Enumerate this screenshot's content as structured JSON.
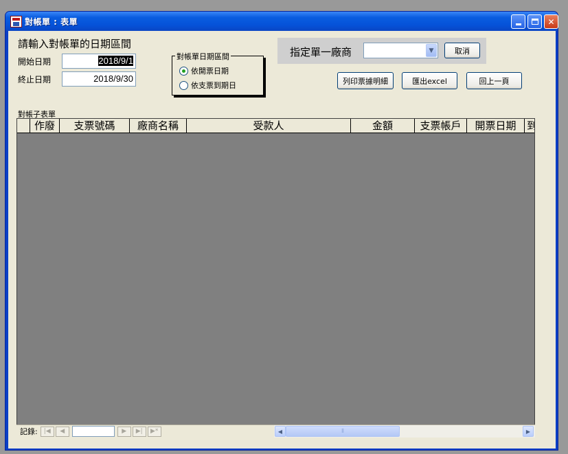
{
  "window": {
    "title": "對帳單 : 表單",
    "controls": {
      "minimize": "minimize-icon",
      "maximize": "maximize-icon",
      "close": "close-icon"
    }
  },
  "form": {
    "prompt": "請輸入對帳單的日期區間",
    "start_label": "開始日期",
    "start_value": "2018/9/1",
    "end_label": "終止日期",
    "end_value": "2018/9/30",
    "range_group": {
      "title": "對帳單日期區間",
      "options": [
        {
          "label": "依開票日期",
          "checked": true
        },
        {
          "label": "依支票到期日",
          "checked": false
        }
      ]
    },
    "vendor": {
      "label": "指定單一廠商",
      "selected": "",
      "cancel_label": "取消"
    },
    "buttons": {
      "print": "列印票據明細",
      "export": "匯出excel",
      "back": "回上一頁"
    }
  },
  "subform": {
    "label": "對帳子表單",
    "columns": [
      "",
      "作廢",
      "支票號碼",
      "廠商名稱",
      "受款人",
      "金額",
      "支票帳戶",
      "開票日期",
      "到"
    ],
    "rows": []
  },
  "navigation": {
    "record_label": "記錄:",
    "record_value": ""
  },
  "colors": {
    "title_bar": "#0a5de0",
    "client_bg": "#ece9d8",
    "grid_bg": "#808080",
    "vendor_panel_bg": "#cfcfcf"
  }
}
